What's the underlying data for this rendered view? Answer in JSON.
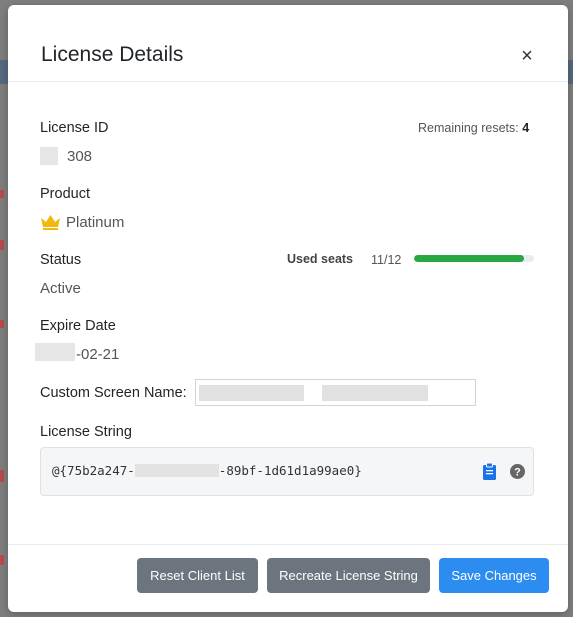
{
  "modal": {
    "title": "License Details",
    "close_glyph": "×"
  },
  "license_id": {
    "label": "License ID",
    "value": "308",
    "remaining_resets_label": "Remaining resets:",
    "remaining_resets_value": "4"
  },
  "product": {
    "label": "Product",
    "icon": "crown-icon",
    "value": "Platinum"
  },
  "status": {
    "label": "Status",
    "value": "Active",
    "used_seats_label": "Used seats",
    "used_seats_text": "11/12",
    "used_seats_fraction": 0.9167,
    "bar_color": "#28a745"
  },
  "expire_date": {
    "label": "Expire Date",
    "value_suffix": "-02-21"
  },
  "custom_screen_name": {
    "label": "Custom Screen Name:"
  },
  "license_string": {
    "label": "License String",
    "prefix": "@{75b2a247-",
    "suffix": "-89bf-1d61d1a99ae0}",
    "copy_icon": "clipboard-icon",
    "help_icon": "help-icon",
    "accent": "#1a73e8"
  },
  "footer": {
    "reset_client_list": "Reset Client List",
    "recreate_license_string": "Recreate License String",
    "save_changes": "Save Changes"
  }
}
